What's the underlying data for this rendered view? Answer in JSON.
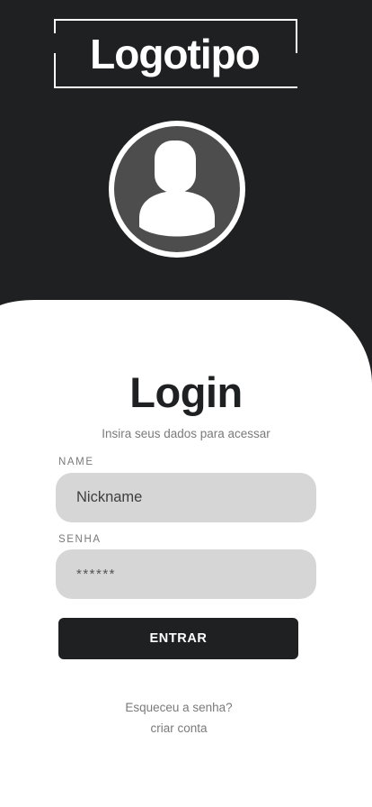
{
  "header": {
    "logo_text": "Logotipo",
    "avatar_icon": "user-avatar-icon"
  },
  "login": {
    "title": "Login",
    "subtitle": "Insira seus dados para acessar",
    "name_label": "NAME",
    "name_placeholder": "Nickname",
    "password_label": "SENHA",
    "password_placeholder": "******",
    "submit_label": "ENTRAR",
    "forgot_link": "Esqueceu a senha?",
    "create_link": "criar conta"
  },
  "colors": {
    "background_dark": "#1e2021",
    "panel": "#ffffff",
    "input_bg": "#d6d6d6",
    "muted_text": "#7a7a7a"
  }
}
